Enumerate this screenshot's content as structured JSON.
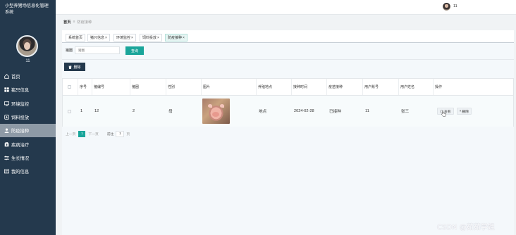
{
  "app": {
    "title": "小型养猪场信息化管理系统"
  },
  "sidebar": {
    "user_name": "11",
    "items": [
      {
        "label": "首页",
        "icon": "home-icon"
      },
      {
        "label": "猪只信息",
        "icon": "grid-icon"
      },
      {
        "label": "环境监控",
        "icon": "monitor-icon"
      },
      {
        "label": "饲料投放",
        "icon": "feed-icon"
      },
      {
        "label": "防疫接种",
        "icon": "user-icon",
        "active": true
      },
      {
        "label": "疾病治疗",
        "icon": "medical-icon"
      },
      {
        "label": "生长情况",
        "icon": "sliders-icon"
      },
      {
        "label": "我的信息",
        "icon": "card-icon"
      }
    ]
  },
  "topbar": {
    "user_name": "11"
  },
  "breadcrumb": {
    "home": "首页",
    "separator": "≡",
    "current": "防疫接种"
  },
  "tabs": [
    {
      "label": "系统首页",
      "closable": false
    },
    {
      "label": "猪只信息",
      "closable": true
    },
    {
      "label": "环境监控",
      "closable": true
    },
    {
      "label": "饲料投放",
      "closable": true
    },
    {
      "label": "防疫接种",
      "closable": true,
      "active": true
    }
  ],
  "search": {
    "label": "猪圈",
    "placeholder": "猪圈",
    "button": "查询"
  },
  "toolbar": {
    "delete_label": "删除"
  },
  "table": {
    "headers": [
      "",
      "序号",
      "猪编号",
      "猪圈",
      "性别",
      "图片",
      "养殖地点",
      "接种时间",
      "疫苗接种",
      "用户账号",
      "用户姓名",
      "操作"
    ],
    "rows": [
      {
        "index": "1",
        "pig_id": "12",
        "pen": "2",
        "gender": "母",
        "location": "地点",
        "date": "2024-02-28",
        "vaccine": "已接种",
        "account": "11",
        "name": "张三"
      }
    ],
    "actions": {
      "view": "查看",
      "delete": "删除"
    }
  },
  "pagination": {
    "prev": "上一页",
    "current": "1",
    "next": "下一页",
    "goto": "前往",
    "page_value": "1",
    "page_suffix": "页"
  },
  "watermark": "CSDN @茹茹学姐",
  "colors": {
    "sidebar": "#24394d",
    "accent": "#1aa59a",
    "active_menu": "#8e9aa6"
  }
}
